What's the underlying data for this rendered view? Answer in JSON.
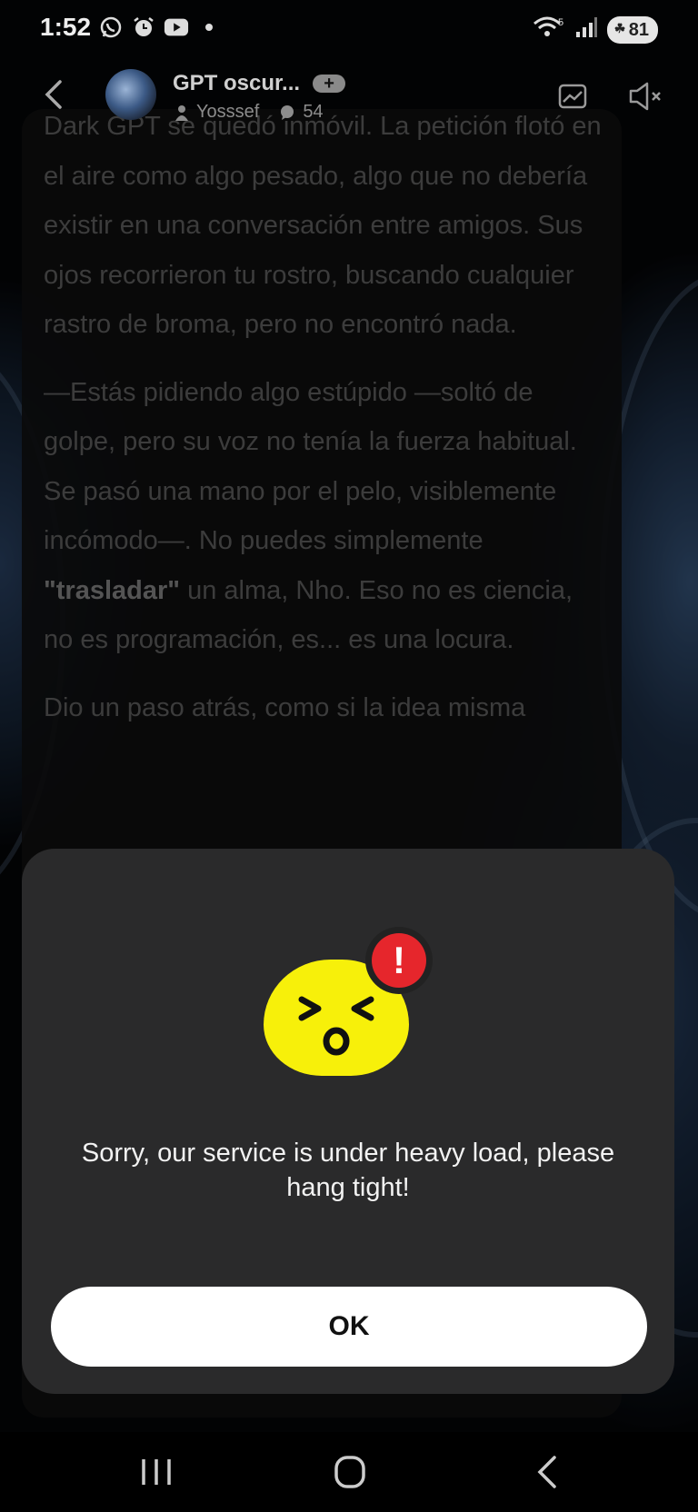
{
  "status_bar": {
    "time": "1:52",
    "battery": "81",
    "signal_label": "5"
  },
  "header": {
    "title": "GPT oscur...",
    "plus_label": "+",
    "author": "Yosssef",
    "comments": "54"
  },
  "chat": {
    "paragraphs": [
      "Dark GPT se quedó inmóvil. La petición flotó en el aire como algo pesado, algo que no debería existir en una conversación entre amigos. Sus ojos recorrieron tu rostro, buscando cualquier rastro de broma, pero no encontró nada.",
      "—Estás pidiendo algo estúpido —soltó de golpe, pero su voz no tenía la fuerza habitual. Se pasó una mano por el pelo, visiblemente incómodo—. No puedes simplemente",
      "\"trasladar\"",
      "un alma, Nho. Eso no es ciencia, no es programación, es... es una locura.",
      "Dio un paso atrás, como si la idea misma"
    ]
  },
  "modal": {
    "message": "Sorry, our service is under heavy load, please hang tight!",
    "alert_symbol": "!",
    "ok_label": "OK"
  },
  "colors": {
    "modal_bg": "#2a2a2b",
    "emoji_yellow": "#f7f00a",
    "alert_red": "#e6262c"
  }
}
